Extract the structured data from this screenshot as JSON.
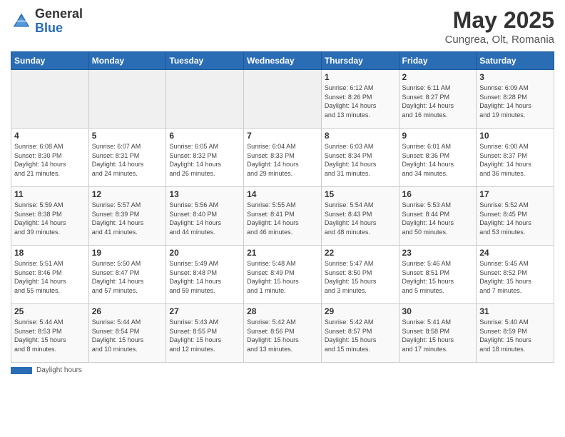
{
  "header": {
    "logo_general": "General",
    "logo_blue": "Blue",
    "title": "May 2025",
    "subtitle": "Cungrea, Olt, Romania"
  },
  "days_of_week": [
    "Sunday",
    "Monday",
    "Tuesday",
    "Wednesday",
    "Thursday",
    "Friday",
    "Saturday"
  ],
  "footer": {
    "label": "Daylight hours"
  },
  "weeks": [
    [
      {
        "day": "",
        "info": ""
      },
      {
        "day": "",
        "info": ""
      },
      {
        "day": "",
        "info": ""
      },
      {
        "day": "",
        "info": ""
      },
      {
        "day": "1",
        "info": "Sunrise: 6:12 AM\nSunset: 8:26 PM\nDaylight: 14 hours\nand 13 minutes."
      },
      {
        "day": "2",
        "info": "Sunrise: 6:11 AM\nSunset: 8:27 PM\nDaylight: 14 hours\nand 16 minutes."
      },
      {
        "day": "3",
        "info": "Sunrise: 6:09 AM\nSunset: 8:28 PM\nDaylight: 14 hours\nand 19 minutes."
      }
    ],
    [
      {
        "day": "4",
        "info": "Sunrise: 6:08 AM\nSunset: 8:30 PM\nDaylight: 14 hours\nand 21 minutes."
      },
      {
        "day": "5",
        "info": "Sunrise: 6:07 AM\nSunset: 8:31 PM\nDaylight: 14 hours\nand 24 minutes."
      },
      {
        "day": "6",
        "info": "Sunrise: 6:05 AM\nSunset: 8:32 PM\nDaylight: 14 hours\nand 26 minutes."
      },
      {
        "day": "7",
        "info": "Sunrise: 6:04 AM\nSunset: 8:33 PM\nDaylight: 14 hours\nand 29 minutes."
      },
      {
        "day": "8",
        "info": "Sunrise: 6:03 AM\nSunset: 8:34 PM\nDaylight: 14 hours\nand 31 minutes."
      },
      {
        "day": "9",
        "info": "Sunrise: 6:01 AM\nSunset: 8:36 PM\nDaylight: 14 hours\nand 34 minutes."
      },
      {
        "day": "10",
        "info": "Sunrise: 6:00 AM\nSunset: 8:37 PM\nDaylight: 14 hours\nand 36 minutes."
      }
    ],
    [
      {
        "day": "11",
        "info": "Sunrise: 5:59 AM\nSunset: 8:38 PM\nDaylight: 14 hours\nand 39 minutes."
      },
      {
        "day": "12",
        "info": "Sunrise: 5:57 AM\nSunset: 8:39 PM\nDaylight: 14 hours\nand 41 minutes."
      },
      {
        "day": "13",
        "info": "Sunrise: 5:56 AM\nSunset: 8:40 PM\nDaylight: 14 hours\nand 44 minutes."
      },
      {
        "day": "14",
        "info": "Sunrise: 5:55 AM\nSunset: 8:41 PM\nDaylight: 14 hours\nand 46 minutes."
      },
      {
        "day": "15",
        "info": "Sunrise: 5:54 AM\nSunset: 8:43 PM\nDaylight: 14 hours\nand 48 minutes."
      },
      {
        "day": "16",
        "info": "Sunrise: 5:53 AM\nSunset: 8:44 PM\nDaylight: 14 hours\nand 50 minutes."
      },
      {
        "day": "17",
        "info": "Sunrise: 5:52 AM\nSunset: 8:45 PM\nDaylight: 14 hours\nand 53 minutes."
      }
    ],
    [
      {
        "day": "18",
        "info": "Sunrise: 5:51 AM\nSunset: 8:46 PM\nDaylight: 14 hours\nand 55 minutes."
      },
      {
        "day": "19",
        "info": "Sunrise: 5:50 AM\nSunset: 8:47 PM\nDaylight: 14 hours\nand 57 minutes."
      },
      {
        "day": "20",
        "info": "Sunrise: 5:49 AM\nSunset: 8:48 PM\nDaylight: 14 hours\nand 59 minutes."
      },
      {
        "day": "21",
        "info": "Sunrise: 5:48 AM\nSunset: 8:49 PM\nDaylight: 15 hours\nand 1 minute."
      },
      {
        "day": "22",
        "info": "Sunrise: 5:47 AM\nSunset: 8:50 PM\nDaylight: 15 hours\nand 3 minutes."
      },
      {
        "day": "23",
        "info": "Sunrise: 5:46 AM\nSunset: 8:51 PM\nDaylight: 15 hours\nand 5 minutes."
      },
      {
        "day": "24",
        "info": "Sunrise: 5:45 AM\nSunset: 8:52 PM\nDaylight: 15 hours\nand 7 minutes."
      }
    ],
    [
      {
        "day": "25",
        "info": "Sunrise: 5:44 AM\nSunset: 8:53 PM\nDaylight: 15 hours\nand 8 minutes."
      },
      {
        "day": "26",
        "info": "Sunrise: 5:44 AM\nSunset: 8:54 PM\nDaylight: 15 hours\nand 10 minutes."
      },
      {
        "day": "27",
        "info": "Sunrise: 5:43 AM\nSunset: 8:55 PM\nDaylight: 15 hours\nand 12 minutes."
      },
      {
        "day": "28",
        "info": "Sunrise: 5:42 AM\nSunset: 8:56 PM\nDaylight: 15 hours\nand 13 minutes."
      },
      {
        "day": "29",
        "info": "Sunrise: 5:42 AM\nSunset: 8:57 PM\nDaylight: 15 hours\nand 15 minutes."
      },
      {
        "day": "30",
        "info": "Sunrise: 5:41 AM\nSunset: 8:58 PM\nDaylight: 15 hours\nand 17 minutes."
      },
      {
        "day": "31",
        "info": "Sunrise: 5:40 AM\nSunset: 8:59 PM\nDaylight: 15 hours\nand 18 minutes."
      }
    ]
  ]
}
